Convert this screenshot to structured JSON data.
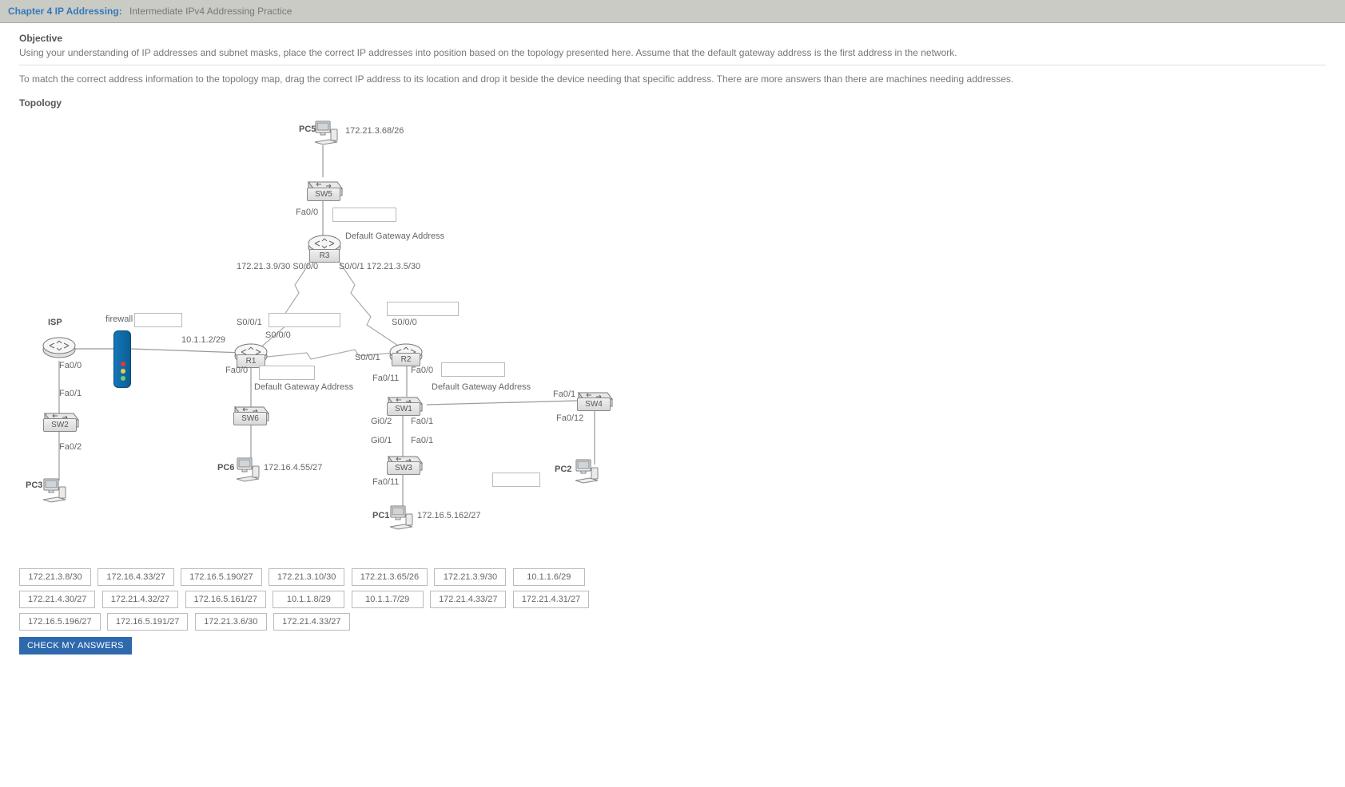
{
  "header": {
    "chapter": "Chapter 4  IP Addressing:",
    "title": "Intermediate IPv4 Addressing Practice"
  },
  "objective": {
    "heading": "Objective",
    "p1": "Using your understanding of IP addresses and subnet masks, place the correct IP addresses into position based on the topology presented here. Assume that the default gateway address is the first address in the network.",
    "p2": "To match the correct address information to the topology map, drag the correct IP address to its location and drop it beside the device needing that specific address. There are more answers than there are machines needing addresses."
  },
  "topology_heading": "Topology",
  "labels": {
    "pc5": "PC5",
    "pc5_ip": "172.21.3.68/26",
    "sw5": "SW5",
    "fa00": "Fa0/0",
    "dga": "Default Gateway Address",
    "r3": "R3",
    "r3_s000": "172.21.3.9/30  S0/0/0",
    "r3_s001": "S0/0/1  172.21.3.5/30",
    "isp": "ISP",
    "firewall": "firewall",
    "r1_s001": "S0/0/1",
    "s000": "S0/0/0",
    "ip_10": "10.1.1.2/29",
    "r1": "R1",
    "r2": "R2",
    "fa01": "Fa0/1",
    "fa02": "Fa0/2",
    "sw2": "SW2",
    "sw6": "SW6",
    "sw1": "SW1",
    "sw3": "SW3",
    "sw4": "SW4",
    "fa011": "Fa0/11",
    "fa012": "Fa0/12",
    "gi02": "Gi0/2",
    "gi01": "Gi0/1",
    "pc6": "PC6",
    "pc6_ip": "172.16.4.55/27",
    "pc3": "PC3",
    "pc1": "PC1",
    "pc1_ip": "172.16.5.162/27",
    "pc2": "PC2",
    "s001": "S0/0/1"
  },
  "answers": {
    "row1": [
      "172.21.3.8/30",
      "172.16.4.33/27",
      "172.16.5.190/27",
      "172.21.3.10/30",
      "172.21.3.65/26",
      "172.21.3.9/30",
      "10.1.1.6/29"
    ],
    "row2": [
      "172.21.4.30/27",
      "172.21.4.32/27",
      "172.16.5.161/27",
      "10.1.1.8/29",
      "10.1.1.7/29",
      "172.21.4.33/27",
      "172.21.4.31/27"
    ],
    "row3": [
      "172.16.5.196/27",
      "172.16.5.191/27",
      "172.21.3.6/30",
      "172.21.4.33/27"
    ]
  },
  "check_label": "CHECK MY ANSWERS"
}
